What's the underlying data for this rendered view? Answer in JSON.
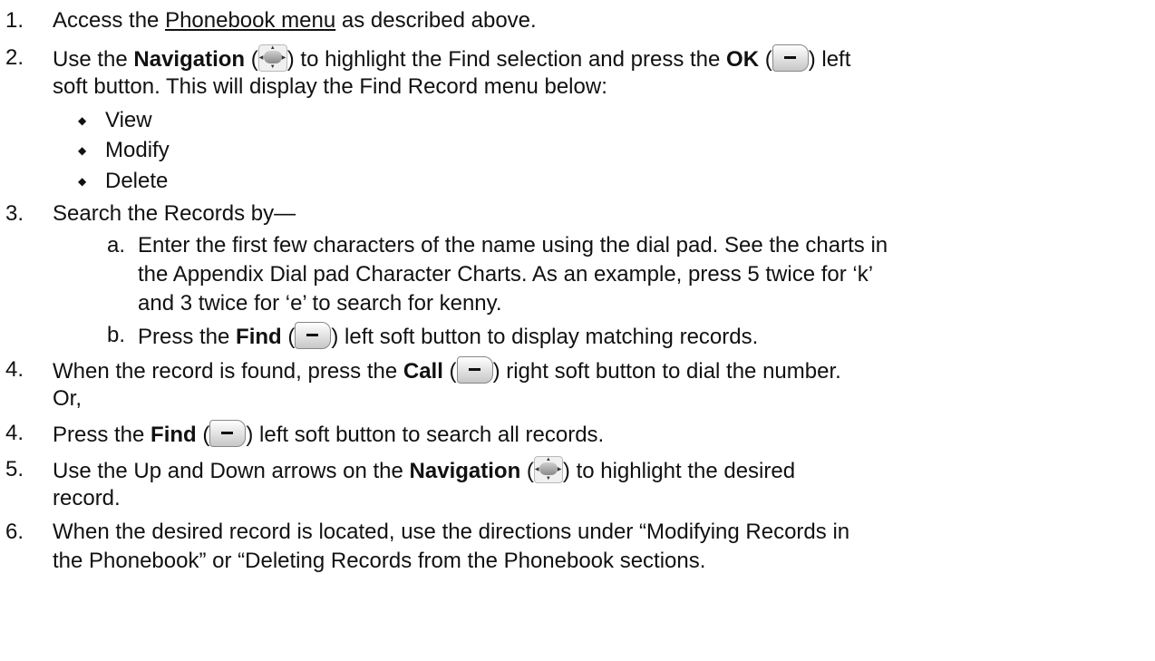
{
  "steps": {
    "s1": {
      "num": "1.",
      "pre": "Access the ",
      "link": "Phonebook menu",
      "post": " as described above."
    },
    "s2": {
      "num": "2.",
      "pre": "Use the ",
      "nav": "Navigation",
      "open": " (",
      "mid": ") to highlight the Find selection and press the ",
      "ok": "OK",
      "open2": " (",
      "post": ") left",
      "line2": "soft button.  This will display the Find Record menu below:"
    },
    "bullets": [
      "View",
      "Modify",
      "Delete"
    ],
    "s3": {
      "num": "3.",
      "text": "Search the Records by—"
    },
    "s3a": {
      "letter": "a.",
      "l1": "Enter the first few characters of the name using the dial pad.  See the charts in",
      "l2": "the Appendix Dial pad Character Charts.  As an example, press 5 twice for ‘k’",
      "l3": "and 3 twice for ‘e’ to search for kenny."
    },
    "s3b": {
      "letter": "b.",
      "pre": "Press the ",
      "find": "Find",
      "open": " (",
      "post": ") left soft button to display matching records."
    },
    "s4": {
      "num": "4.",
      "pre": "When the record is found, press the ",
      "call": "Call",
      "open": " (",
      "post": ") right soft button to dial the number.",
      "line2": "Or,"
    },
    "s4b": {
      "num": "4.",
      "pre": "Press the ",
      "find": "Find",
      "open": " (",
      "post": ") left soft button to search all records."
    },
    "s5": {
      "num": "5.",
      "pre": "Use the Up and Down arrows on the ",
      "nav": "Navigation",
      "open": " (",
      "post": ") to highlight the desired",
      "line2": "record."
    },
    "s6": {
      "num": "6.",
      "l1": "When the desired record is located, use the directions under “Modifying Records in",
      "l2": "the Phonebook” or “Deleting Records from the Phonebook sections."
    }
  },
  "icons": {
    "navigation": "navigation-key-icon",
    "soft_button": "soft-button-icon",
    "bullet": "diamond-bullet-icon"
  }
}
